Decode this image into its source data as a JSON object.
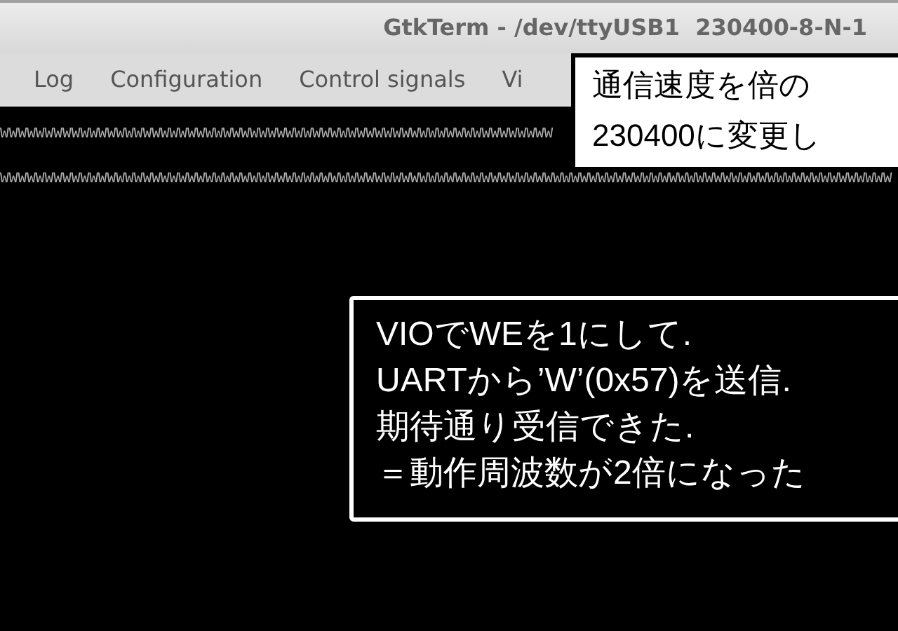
{
  "window": {
    "title": "GtkTerm - /dev/ttyUSB1  230400-8-N-1"
  },
  "menu": [
    "Log",
    "Configuration",
    "Control signals",
    "Vi"
  ],
  "terminal": {
    "lines": [
      "WWWWWWWWWWWWWWWWWWWWWWWWWWWWWWWWWWWWWWWWWWWWWWWWWWWWWWWWWWWWWW",
      "WWWWWWWWWWWWWWWWWWWWWWWWWWWWWWWWWWWWWWWWWWWWWWWWWWWWWWWWWWWWWWWWWWWWWWWWWWWWWWWWWWWWWWWWWWWWWWWWWWWW"
    ]
  },
  "annotations": [
    {
      "kind": "light",
      "lines": [
        "通信速度を倍の",
        "230400に変更し"
      ]
    },
    {
      "kind": "dark",
      "lines": [
        "VIOでWEを1にして.",
        "UARTから’W’(0x57)を送信.",
        "期待通り受信できた.",
        "＝動作周波数が2倍になった"
      ]
    }
  ]
}
